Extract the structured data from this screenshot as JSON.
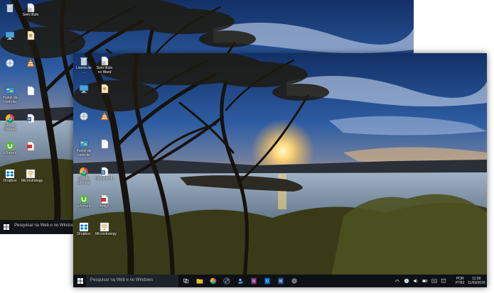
{
  "back_screen": {
    "desktop_icons": [
      {
        "label": "",
        "icon": "recycle-bin-icon"
      },
      {
        "label": "Sem título",
        "icon": "file-shortcut-icon"
      },
      {
        "label": "",
        "icon": "computer-icon"
      },
      {
        "label": "",
        "icon": "document-icon"
      },
      {
        "label": "",
        "icon": "network-icon"
      },
      {
        "label": "",
        "icon": "vlc-icon"
      },
      {
        "label": "Painel de controle",
        "icon": "control-panel-icon"
      },
      {
        "label": "",
        "icon": "blank-document-icon"
      },
      {
        "label": "Google Chrome",
        "icon": "chrome-icon"
      },
      {
        "label": "",
        "icon": "word-document-icon"
      },
      {
        "label": "uTorrent",
        "icon": "utorrent-icon"
      },
      {
        "label": "",
        "icon": "pdf-document-icon"
      },
      {
        "label": "Dropbox",
        "icon": "dropbox-icon"
      },
      {
        "label": "Microstrategy",
        "icon": "wifi-icon"
      }
    ],
    "taskbar": {
      "search_text": "Pesquisar na Web e no Windows"
    }
  },
  "front_screen": {
    "desktop_icons": [
      {
        "label": "Lixeira de ...",
        "icon": "recycle-bin-icon"
      },
      {
        "label": "Sem título no Ward",
        "icon": "file-shortcut-icon"
      },
      {
        "label": "",
        "icon": "computer-icon"
      },
      {
        "label": "",
        "icon": "document-icon"
      },
      {
        "label": "",
        "icon": "network-icon"
      },
      {
        "label": "",
        "icon": "vlc-icon"
      },
      {
        "label": "Painel de controle",
        "icon": "control-panel-icon"
      },
      {
        "label": "",
        "icon": "blank-document-icon"
      },
      {
        "label": "Google Chrome",
        "icon": "chrome-icon"
      },
      {
        "label": "Documento",
        "icon": "word-document-icon"
      },
      {
        "label": "uTorrent",
        "icon": "utorrent-icon"
      },
      {
        "label": "Artigo",
        "icon": "pdf-document-icon"
      },
      {
        "label": "Dropbox",
        "icon": "dropbox-icon"
      },
      {
        "label": "Microstrategy",
        "icon": "wifi-icon"
      }
    ],
    "taskbar": {
      "search_text": "Pesquisar na Web e no Windows",
      "pinned": [
        {
          "icon": "task-view-icon"
        },
        {
          "icon": "file-explorer-icon"
        },
        {
          "icon": "chrome-icon"
        },
        {
          "icon": "steam-icon"
        },
        {
          "icon": "people-icon"
        },
        {
          "icon": "onenote-icon"
        },
        {
          "icon": "outlook-icon"
        },
        {
          "icon": "word-icon"
        },
        {
          "icon": "settings-gear-icon"
        }
      ],
      "tray": [
        {
          "icon": "chevron-up-icon"
        },
        {
          "icon": "network-icon"
        },
        {
          "icon": "volume-icon"
        },
        {
          "icon": "battery-icon"
        },
        {
          "icon": "keyboard-icon"
        },
        {
          "icon": "action-center-icon"
        }
      ],
      "language": "POR",
      "layout": "PTB2",
      "time": "11:09",
      "date": "11/03/2016"
    }
  },
  "colors": {
    "taskbar": "#0d1116",
    "sun": "#ffd77a",
    "sky_top": "#1a3c78",
    "water": "#8fa4b8"
  }
}
